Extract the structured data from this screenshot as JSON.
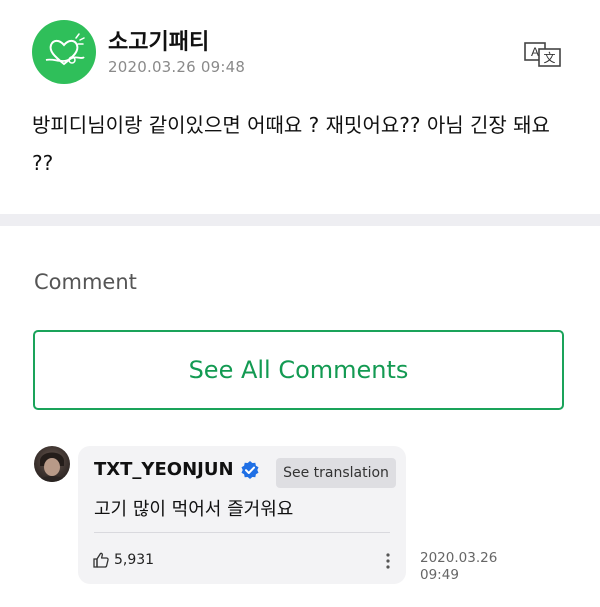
{
  "post": {
    "author": "소고기패티",
    "timestamp": "2020.03.26 09:48",
    "body": "방피디님이랑 같이있으면 어때요 ? 재밋어요?? 아님 긴장 돼요 ??",
    "avatar_icon": "green-heart-doodle-avatar",
    "translate_icon": "translate-icon"
  },
  "comments_section": {
    "heading": "Comment",
    "see_all_label": "See All Comments"
  },
  "comment": {
    "username": "TXT_YEONJUN",
    "verified_icon": "verified-badge-icon",
    "translate_button": "See translation",
    "text": "고기 많이 먹어서 즐거워요",
    "likes": "5,931",
    "like_icon": "thumbs-up-icon",
    "more_icon": "more-vertical-icon",
    "date": "2020.03.26",
    "time": "09:49"
  },
  "colors": {
    "accent_green": "#139a52",
    "avatar_green": "#2fbf5a",
    "verified_blue": "#1f6fe5",
    "card_bg": "#f3f3f5",
    "divider": "#eeeef2"
  }
}
